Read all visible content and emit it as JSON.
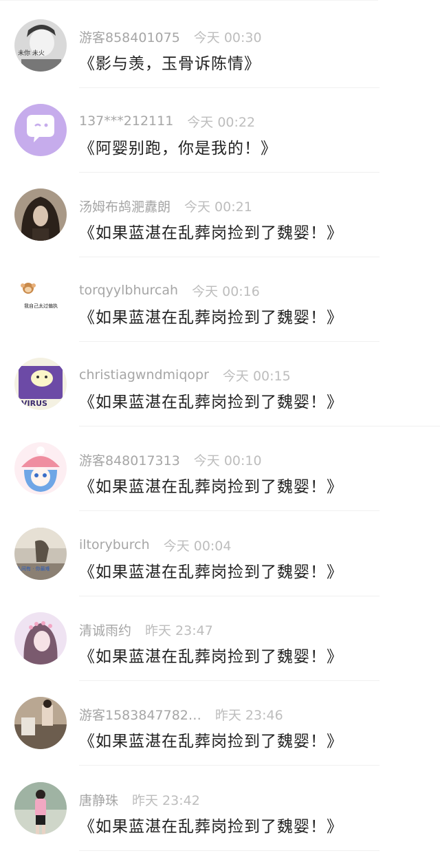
{
  "comments": [
    {
      "user": "游客858401075",
      "time": "今天 00:30",
      "title": "《影与羡，玉骨诉陈情》",
      "avatar": "avatar-bw-photo"
    },
    {
      "user": "137***212111",
      "time": "今天 00:22",
      "title": "《阿婴别跑，你是我的！》",
      "avatar": "avatar-chat-bubble"
    },
    {
      "user": "汤姆布鸪淝纛朗",
      "time": "今天 00:21",
      "title": "《如果蓝湛在乱葬岗捡到了魏婴！》",
      "avatar": "avatar-dark-hair"
    },
    {
      "user": "torqyylbhurcah",
      "time": "今天 00:16",
      "title": "《如果蓝湛在乱葬岗捡到了魏婴！》",
      "avatar": "avatar-monkey-sticker"
    },
    {
      "user": "christiagwndmiqopr",
      "time": "今天 00:15",
      "title": "《如果蓝湛在乱葬岗捡到了魏婴！》",
      "avatar": "avatar-purple-cartoon"
    },
    {
      "user": "游客848017313",
      "time": "今天 00:10",
      "title": "《如果蓝湛在乱葬岗捡到了魏婴！》",
      "avatar": "avatar-anime-girl"
    },
    {
      "user": "iltoryburch",
      "time": "今天 00:04",
      "title": "《如果蓝湛在乱葬岗捡到了魏婴！》",
      "avatar": "avatar-room-photo"
    },
    {
      "user": "清诚雨约",
      "time": "昨天 23:47",
      "title": "《如果蓝湛在乱葬岗捡到了魏婴！》",
      "avatar": "avatar-flower-girl"
    },
    {
      "user": "游客1583847782…",
      "time": "昨天 23:46",
      "title": "《如果蓝湛在乱葬岗捡到了魏婴！》",
      "avatar": "avatar-street-photo"
    },
    {
      "user": "唐静珠",
      "time": "昨天 23:42",
      "title": "《如果蓝湛在乱葬岗捡到了魏婴！》",
      "avatar": "avatar-pink-outfit"
    }
  ],
  "avatar_texts": {
    "bw_photo": "未你  未火",
    "monkey_sticker": "我自己太过偏执",
    "purple_cartoon": "VIRUS",
    "room_photo": "人间有 · 你最难"
  }
}
